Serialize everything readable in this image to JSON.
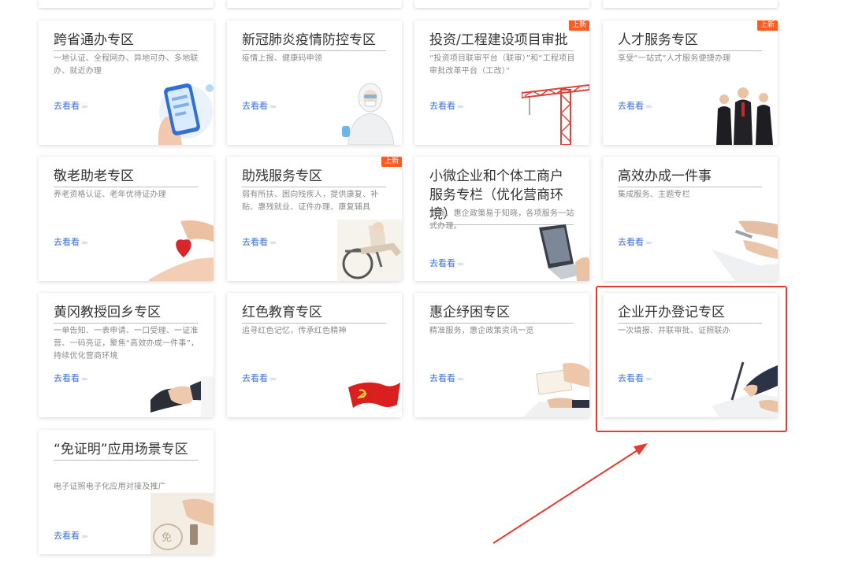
{
  "more_label": "去看看",
  "more_chevron": "»»",
  "badge_new": "上新",
  "colors": {
    "accent_blue": "#3d6fd6",
    "badge_orange": "#ff5a1f",
    "highlight_red": "#e53a2f"
  },
  "cards": [
    {
      "title": "跨省通办专区",
      "desc": "一地认证、全程网办、异地可办、多地联办、就近办理",
      "icon": "phone-hand-icon"
    },
    {
      "title": "新冠肺炎疫情防控专区",
      "desc": "疫情上报、健康码申领",
      "icon": "protective-suit-icon"
    },
    {
      "title": "投资/工程建设项目审批",
      "desc": "“投资项目联审平台（联审）”和“工程项目审批改革平台（工改）”",
      "icon": "tower-crane-icon",
      "badge": true
    },
    {
      "title": "人才服务专区",
      "desc": "享受“一站式”人才服务便捷办理",
      "icon": "business-people-icon",
      "badge": true
    },
    {
      "title": "敬老助老专区",
      "desc": "养老资格认证、老年优待证办理",
      "icon": "heart-hands-icon"
    },
    {
      "title": "助残服务专区",
      "desc": "弱有所扶、困向残疾人，提供康复、补贴、惠残就业、证件办理、康复辅具",
      "icon": "wheelchair-icon",
      "badge": true
    },
    {
      "title": "小微企业和个体工商户服务专栏（优化营商环境）",
      "desc": "营商、惠企政策易于知晓，各项服务一站式办理。",
      "icon": "laptop-icon"
    },
    {
      "title": "高效办成一件事",
      "desc": "集成服务、主题专栏",
      "icon": "signing-hands-icon"
    },
    {
      "title": "黄冈教授回乡专区",
      "desc": "一单告知、一表申请、一口受理、一证准营、一码亮证，聚焦“高效办成一件事”，持续优化营商环境",
      "icon": "handshake-icon"
    },
    {
      "title": "红色教育专区",
      "desc": "追寻红色记忆，传承红色精神",
      "icon": "red-flag-icon"
    },
    {
      "title": "惠企纾困专区",
      "desc": "精准服务，惠企政策资讯一览",
      "icon": "document-hands-icon"
    },
    {
      "title": "企业开办登记专区",
      "desc": "一次填报、并联审批、证照联办",
      "icon": "pen-signing-icon"
    },
    {
      "title": "“免证明”应用场景专区",
      "desc": "电子证照电子化应用对接及推广",
      "icon": "stamp-icon"
    }
  ]
}
